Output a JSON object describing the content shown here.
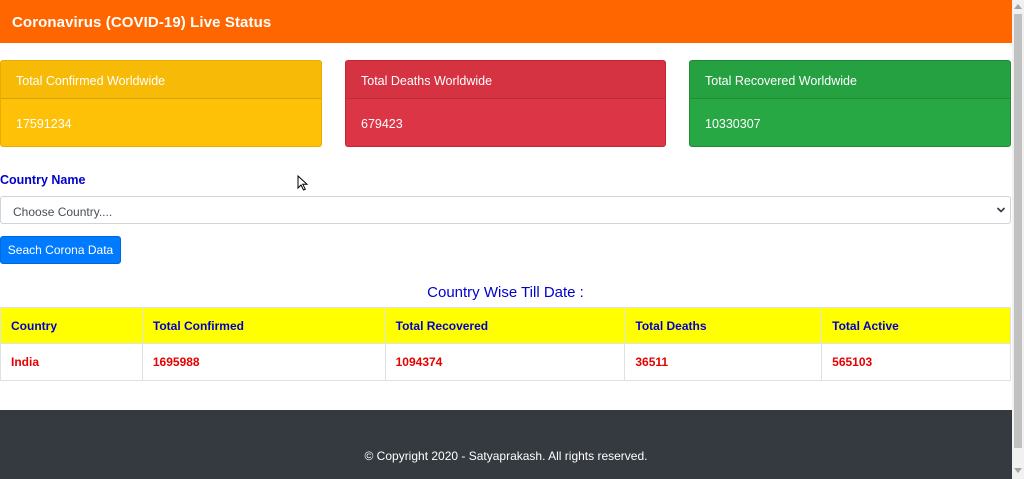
{
  "header": {
    "title": "Coronavirus (COVID-19) Live Status"
  },
  "cards": {
    "confirmed": {
      "label": "Total Confirmed Worldwide",
      "value": "17591234",
      "color": "#ffc107"
    },
    "deaths": {
      "label": "Total Deaths Worldwide",
      "value": "679423",
      "color": "#dc3545"
    },
    "recovered": {
      "label": "Total Recovered Worldwide",
      "value": "10330307",
      "color": "#28a745"
    }
  },
  "form": {
    "label": "Country Name",
    "select_value": "Choose Country....",
    "button_label": "Seach Corona Data"
  },
  "table": {
    "title": "Country Wise Till Date :",
    "headers": [
      "Country",
      "Total Confirmed",
      "Total Recovered",
      "Total Deaths",
      "Total Active"
    ],
    "rows": [
      [
        "India",
        "1695988",
        "1094374",
        "36511",
        "565103"
      ]
    ]
  },
  "footer": {
    "text": "© Copyright 2020 - Satyaprakash. All rights reserved."
  },
  "colors": {
    "navbar": "#ff6600",
    "button": "#007bff",
    "header_row": "#ffff00",
    "footer": "#343a40"
  },
  "icons": {
    "select_chevron": "chevron-down-icon",
    "cursor": "mouse-cursor-icon"
  }
}
